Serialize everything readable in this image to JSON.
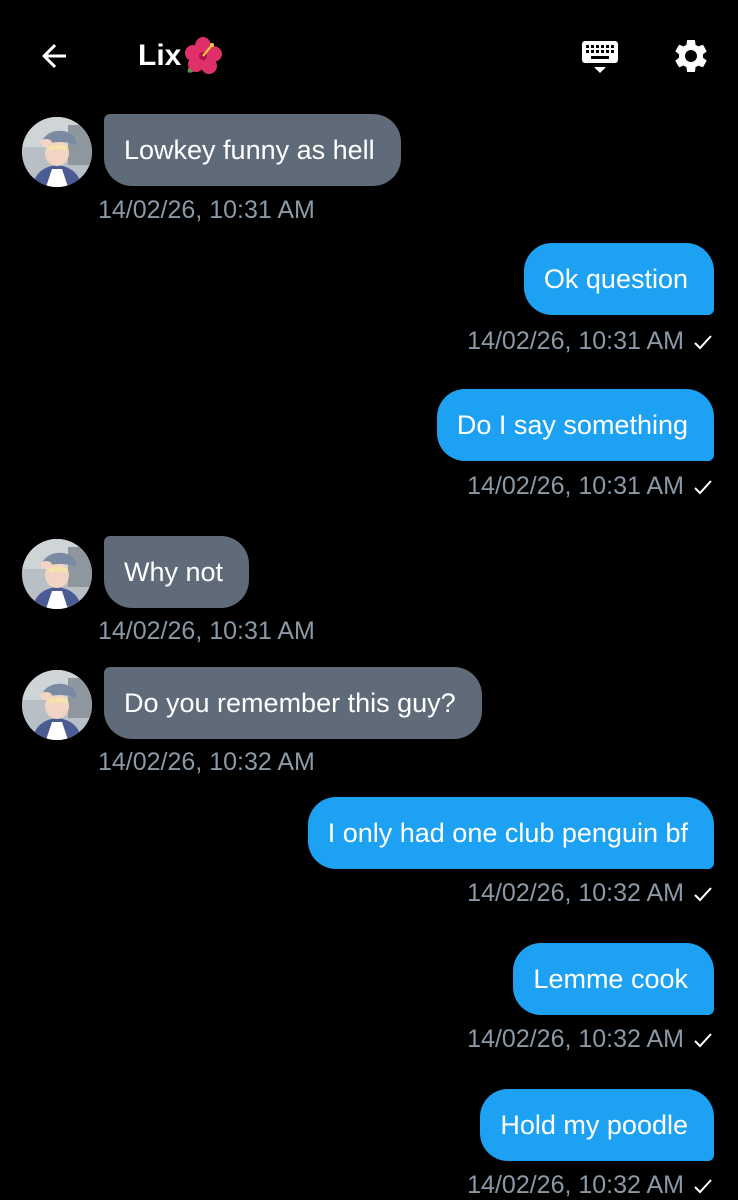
{
  "header": {
    "title": "Lix",
    "back_icon": "arrow-left-icon",
    "keyboard_icon": "keyboard-icon",
    "settings_icon": "gear-icon",
    "title_emoji": "hibiscus"
  },
  "colors": {
    "background": "#000000",
    "incoming_bubble": "#5f6b78",
    "outgoing_bubble": "#1da1f2",
    "timestamp": "#8b98a5"
  },
  "messages": [
    {
      "direction": "in",
      "text": "Lowkey funny as hell",
      "time": "14/02/26, 10:31 AM"
    },
    {
      "direction": "out",
      "text": "Ok question",
      "time": "14/02/26, 10:31 AM",
      "status": "sent"
    },
    {
      "direction": "out",
      "text": "Do I say something",
      "time": "14/02/26, 10:31 AM",
      "status": "sent"
    },
    {
      "direction": "in",
      "text": "Why not",
      "time": "14/02/26, 10:31 AM"
    },
    {
      "direction": "in",
      "text": "Do you remember this guy?",
      "time": "14/02/26, 10:32 AM"
    },
    {
      "direction": "out",
      "text": "I only had one club penguin bf",
      "time": "14/02/26, 10:32 AM",
      "status": "sent"
    },
    {
      "direction": "out",
      "text": "Lemme cook",
      "time": "14/02/26, 10:32 AM",
      "status": "sent"
    },
    {
      "direction": "out",
      "text": "Hold my poodle",
      "time": "14/02/26, 10:32 AM",
      "status": "sent"
    }
  ]
}
